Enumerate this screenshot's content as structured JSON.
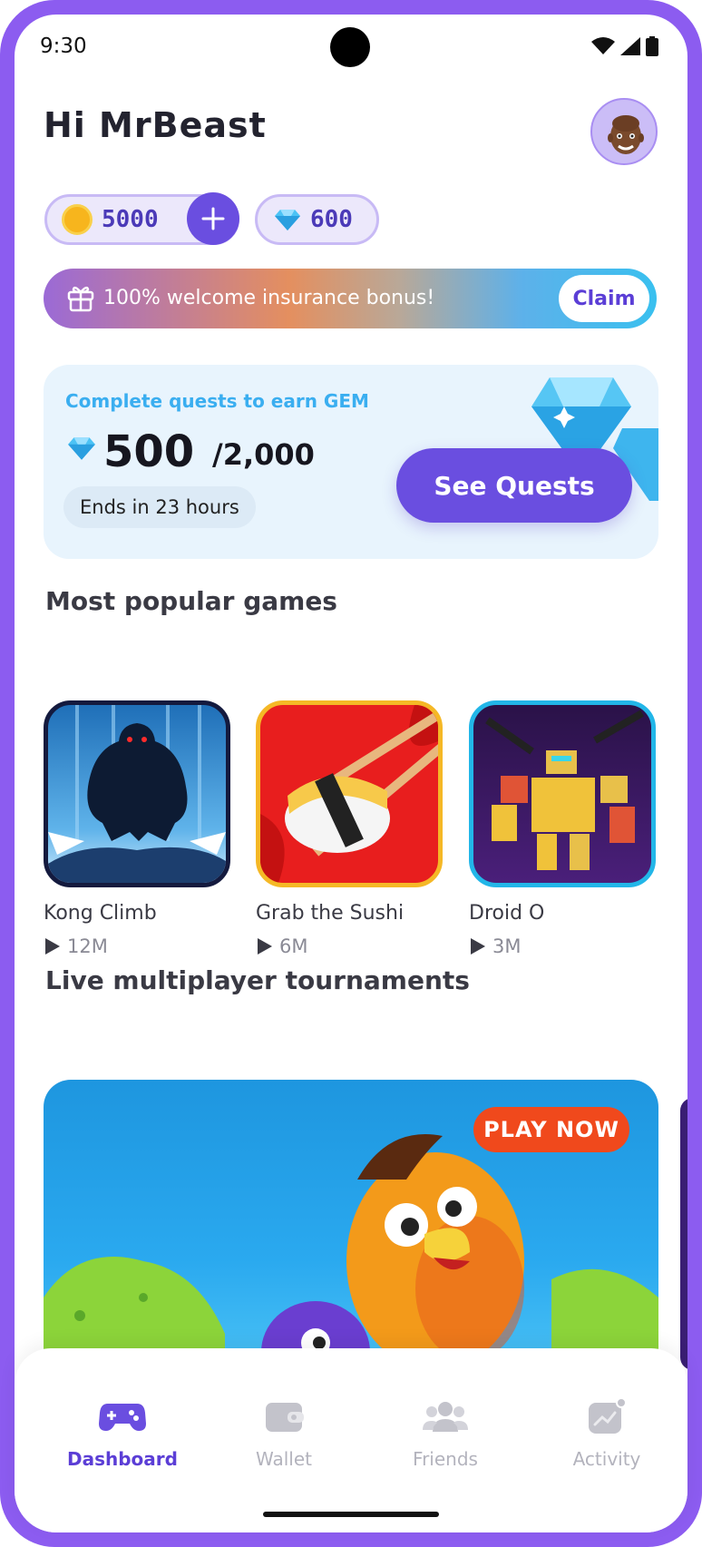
{
  "status_bar": {
    "time": "9:30"
  },
  "header": {
    "greeting": "Hi MrBeast"
  },
  "balances": {
    "coins": "5000",
    "gems": "600"
  },
  "bonus_banner": {
    "text": "100% welcome insurance bonus!",
    "claim_label": "Claim"
  },
  "quest_card": {
    "title": "Complete quests to earn GEM",
    "current": "500",
    "total": "/2,000",
    "ends": "Ends in 23 hours",
    "button_label": "See Quests"
  },
  "popular_games": {
    "title": "Most popular games",
    "items": [
      {
        "name": "Kong Climb",
        "plays": "12M"
      },
      {
        "name": "Grab the Sushi",
        "plays": "6M"
      },
      {
        "name": "Droid O",
        "plays": "3M"
      }
    ]
  },
  "tournaments": {
    "title": "Live multiplayer tournaments",
    "play_label": "PLAY NOW"
  },
  "bottom_nav": {
    "items": [
      {
        "label": "Dashboard",
        "icon": "gamepad-icon",
        "active": true
      },
      {
        "label": "Wallet",
        "icon": "wallet-icon",
        "active": false
      },
      {
        "label": "Friends",
        "icon": "friends-icon",
        "active": false
      },
      {
        "label": "Activity",
        "icon": "activity-icon",
        "active": false
      }
    ]
  },
  "colors": {
    "accent": "#6a4ee0",
    "frame": "#8c5cf0",
    "gem_blue": "#3aaef0",
    "play_now": "#f0491c"
  }
}
